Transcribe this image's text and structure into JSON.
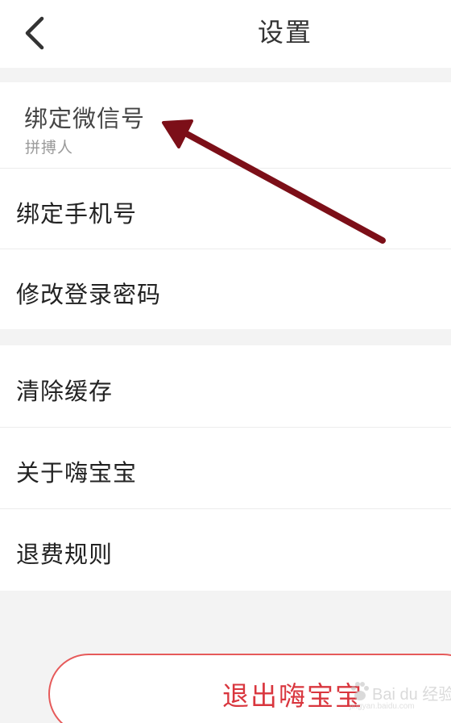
{
  "header": {
    "back_icon": "chevron-left-icon",
    "title": "设置"
  },
  "settings": {
    "account_group": {
      "wechat": {
        "label": "绑定微信号",
        "value": "拼搏人"
      },
      "phone": {
        "label": "绑定手机号"
      },
      "password": {
        "label": "修改登录密码"
      }
    },
    "general_group": {
      "clear_cache": {
        "label": "清除缓存"
      },
      "about": {
        "label": "关于嗨宝宝"
      },
      "refund_rules": {
        "label": "退费规则"
      }
    }
  },
  "logout": {
    "label": "退出嗨宝宝"
  },
  "watermark": {
    "text": "Bai du 经验",
    "sub": "jingyan.baidu.com"
  },
  "colors": {
    "accent_red": "#d9363e",
    "logout_border": "#e65a5a",
    "annotation_arrow": "#7c0f18",
    "background": "#f3f3f3",
    "surface": "#ffffff"
  }
}
